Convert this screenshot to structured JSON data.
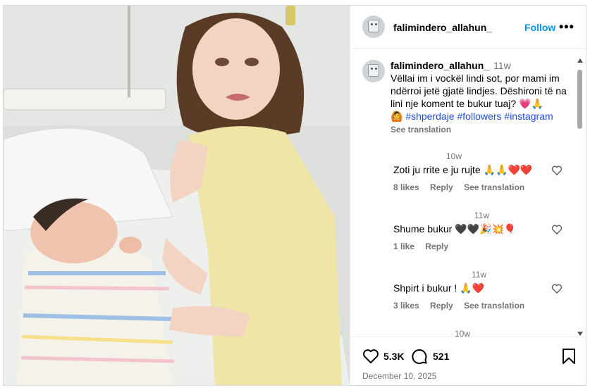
{
  "post": {
    "username": "falimindero_allahun_",
    "follow_label": "Follow",
    "more_label": "•••"
  },
  "caption": {
    "username": "falimindero_allahun_",
    "time": "11w",
    "text": "Vëllai im i vockël lindi sot, por mami im ndërroi jetë gjatë lindjes. Dëshironi të na lini nje koment te bukur  tuaj? 💗🙏",
    "tags": "🙆 #shperdaje #followers #instagram",
    "see_translation": "See translation"
  },
  "comments": [
    {
      "time": "10w",
      "text": "Zoti ju rrite e ju rujte 🙏🙏❤️❤️",
      "likes": "8 likes",
      "reply": "Reply",
      "translate": "See translation"
    },
    {
      "time": "11w",
      "text": "Shume bukur 🖤🖤🎉💥🎈",
      "likes": "1 like",
      "reply": "Reply",
      "translate": ""
    },
    {
      "time": "11w",
      "text": "Shpirt i bukur ! 🙏❤️",
      "likes": "3 likes",
      "reply": "Reply",
      "translate": "See translation"
    },
    {
      "time": "10w",
      "text": "",
      "likes": "",
      "reply": "",
      "translate": ""
    }
  ],
  "actions": {
    "like_count": "5.3K",
    "comment_count": "521",
    "date": "December 10, 2025"
  },
  "colors": {
    "accent": "#0095f6",
    "hashtag": "#1e4fd8",
    "muted": "#737373",
    "border": "#dbdbdb"
  }
}
